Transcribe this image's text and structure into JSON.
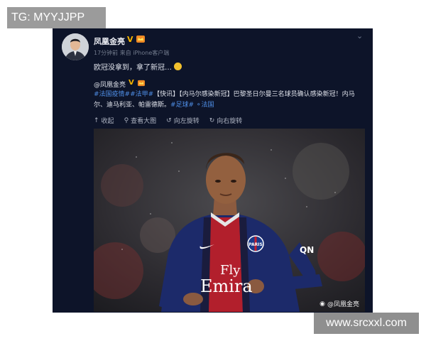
{
  "watermarks": {
    "top_left": "TG: MYYJJPP",
    "bottom_right": "www.srcxxl.com"
  },
  "post": {
    "author": "凤凰金亮",
    "meta": "17分钟前 来自 iPhone客户端",
    "text": "欧冠没拿到，拿了新冠…",
    "text_emoji": "smile-sweat-emoji"
  },
  "repost": {
    "author": "@凤凰金亮",
    "hashtags_line1": "#法国疫情##法甲#",
    "body_line1": "【快讯】【内马尔感染新冠】巴黎圣日尔曼三名球员确认感染新冠！内马",
    "body_line2": "尔、迪马利亚、帕雷德斯。",
    "hashtag_end": "#足球#",
    "location": "法国",
    "actions": [
      {
        "label": "收起",
        "icon": "collapse-icon"
      },
      {
        "label": "查看大图",
        "icon": "zoom-icon"
      },
      {
        "label": "向左旋转",
        "icon": "rotate-left-icon"
      },
      {
        "label": "向右旋转",
        "icon": "rotate-right-icon"
      }
    ],
    "image_credit": "@凤凰金亮",
    "jersey_text_1": "Fly",
    "jersey_text_2": "Emira",
    "jersey_badge": "PARIS"
  },
  "colors": {
    "card_bg": "#0d1429",
    "link": "#4f8fe8",
    "vip": "#f5b400"
  }
}
